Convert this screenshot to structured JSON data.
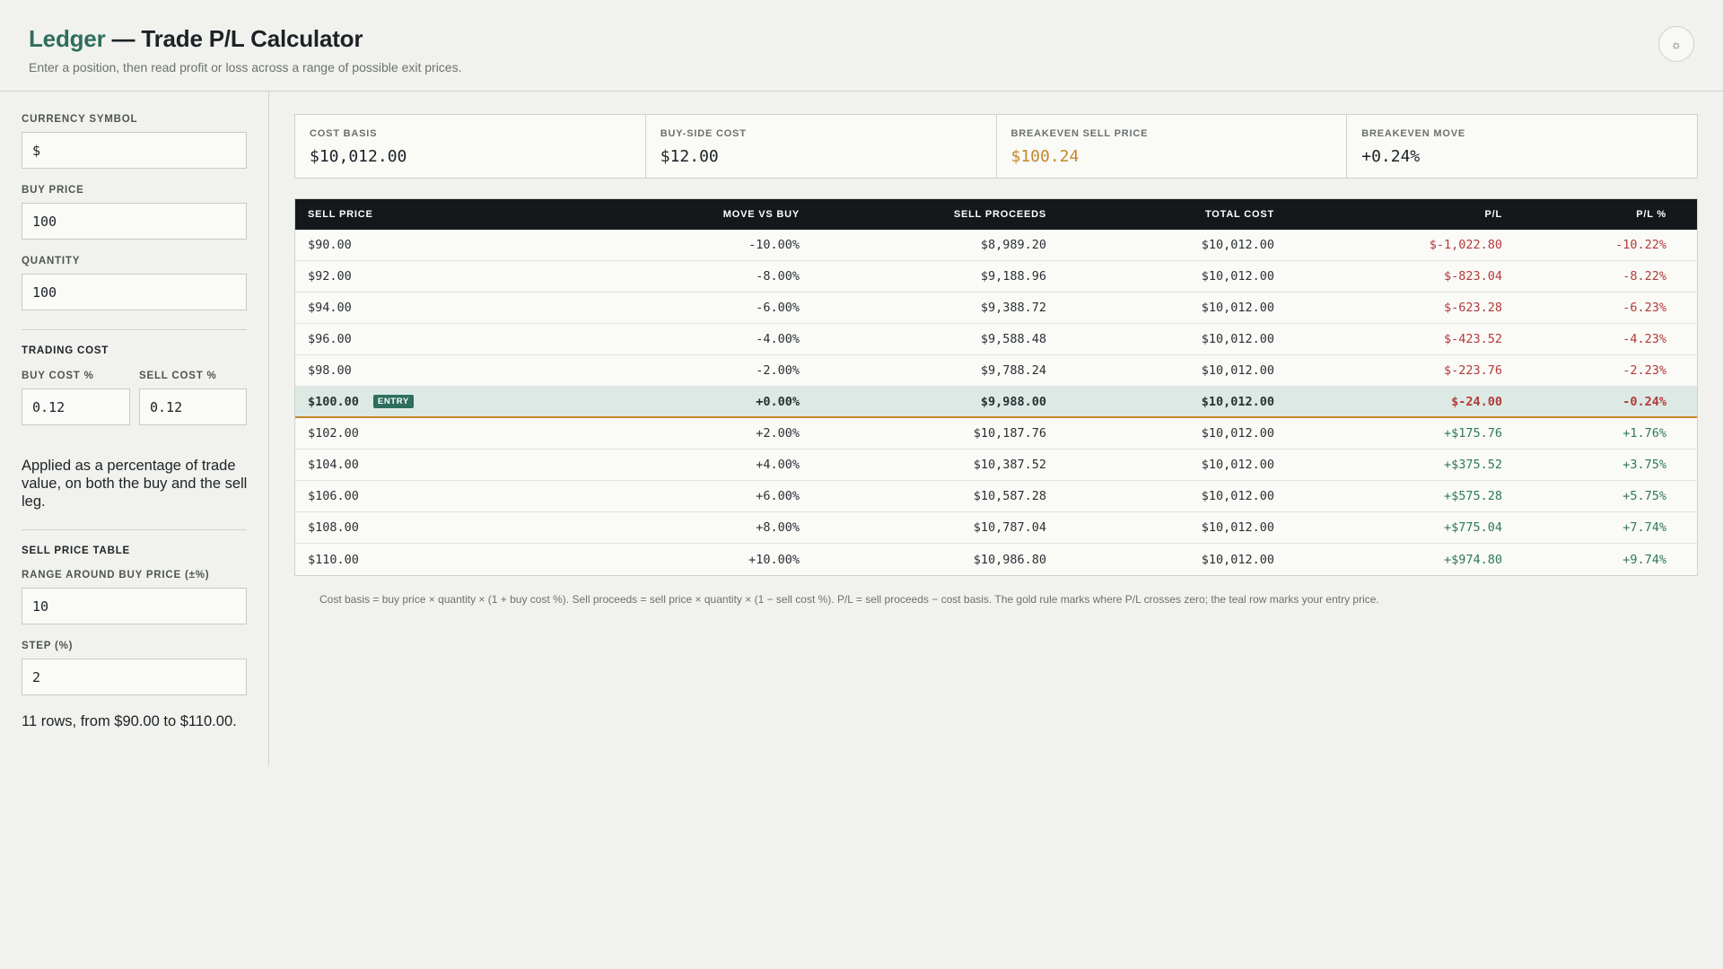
{
  "header": {
    "brand": "Ledger",
    "title_rest": " — Trade P/L Calculator",
    "subtitle": "Enter a position, then read profit or loss across a range of possible exit prices.",
    "theme_icon": "☼"
  },
  "sidebar": {
    "currency_label": "CURRENCY SYMBOL",
    "currency_value": "$",
    "buy_price_label": "BUY PRICE",
    "buy_price_value": "100",
    "quantity_label": "QUANTITY",
    "quantity_value": "100",
    "trading_cost_title": "TRADING COST",
    "buy_cost_label": "BUY COST %",
    "buy_cost_value": "0.12",
    "sell_cost_label": "SELL COST %",
    "sell_cost_value": "0.12",
    "cost_note": "Applied as a percentage of trade value, on both the buy and the sell leg.",
    "sell_table_title": "SELL PRICE TABLE",
    "range_label": "RANGE AROUND BUY PRICE (±%)",
    "range_value": "10",
    "step_label": "STEP (%)",
    "step_value": "2",
    "rows_note": "11 rows, from $90.00 to $110.00."
  },
  "stats": [
    {
      "label": "COST BASIS",
      "value": "$10,012.00",
      "accent": "none"
    },
    {
      "label": "BUY-SIDE COST",
      "value": "$12.00",
      "accent": "none"
    },
    {
      "label": "BREAKEVEN SELL PRICE",
      "value": "$100.24",
      "accent": "gold"
    },
    {
      "label": "BREAKEVEN MOVE",
      "value": "+0.24%",
      "accent": "none"
    }
  ],
  "table": {
    "headers": [
      "SELL PRICE",
      "MOVE VS BUY",
      "SELL PROCEEDS",
      "TOTAL COST",
      "P/L",
      "P/L %"
    ],
    "entry_badge": "ENTRY",
    "rows": [
      {
        "price": "$90.00",
        "move": "-10.00%",
        "proceeds": "$8,989.20",
        "cost": "$10,012.00",
        "pl": "$-1,022.80",
        "plpct": "-10.22%",
        "sign": "neg"
      },
      {
        "price": "$92.00",
        "move": "-8.00%",
        "proceeds": "$9,188.96",
        "cost": "$10,012.00",
        "pl": "$-823.04",
        "plpct": "-8.22%",
        "sign": "neg"
      },
      {
        "price": "$94.00",
        "move": "-6.00%",
        "proceeds": "$9,388.72",
        "cost": "$10,012.00",
        "pl": "$-623.28",
        "plpct": "-6.23%",
        "sign": "neg"
      },
      {
        "price": "$96.00",
        "move": "-4.00%",
        "proceeds": "$9,588.48",
        "cost": "$10,012.00",
        "pl": "$-423.52",
        "plpct": "-4.23%",
        "sign": "neg"
      },
      {
        "price": "$98.00",
        "move": "-2.00%",
        "proceeds": "$9,788.24",
        "cost": "$10,012.00",
        "pl": "$-223.76",
        "plpct": "-2.23%",
        "sign": "neg"
      },
      {
        "price": "$100.00",
        "move": "+0.00%",
        "proceeds": "$9,988.00",
        "cost": "$10,012.00",
        "pl": "$-24.00",
        "plpct": "-0.24%",
        "sign": "neg",
        "entry": true
      },
      {
        "price": "$102.00",
        "move": "+2.00%",
        "proceeds": "$10,187.76",
        "cost": "$10,012.00",
        "pl": "+$175.76",
        "plpct": "+1.76%",
        "sign": "pos"
      },
      {
        "price": "$104.00",
        "move": "+4.00%",
        "proceeds": "$10,387.52",
        "cost": "$10,012.00",
        "pl": "+$375.52",
        "plpct": "+3.75%",
        "sign": "pos"
      },
      {
        "price": "$106.00",
        "move": "+6.00%",
        "proceeds": "$10,587.28",
        "cost": "$10,012.00",
        "pl": "+$575.28",
        "plpct": "+5.75%",
        "sign": "pos"
      },
      {
        "price": "$108.00",
        "move": "+8.00%",
        "proceeds": "$10,787.04",
        "cost": "$10,012.00",
        "pl": "+$775.04",
        "plpct": "+7.74%",
        "sign": "pos"
      },
      {
        "price": "$110.00",
        "move": "+10.00%",
        "proceeds": "$10,986.80",
        "cost": "$10,012.00",
        "pl": "+$974.80",
        "plpct": "+9.74%",
        "sign": "pos"
      }
    ]
  },
  "footnote": "Cost basis = buy price × quantity × (1 + buy cost %). Sell proceeds = sell price × quantity × (1 − sell cost %). P/L = sell proceeds − cost basis. The gold rule marks where P/L crosses zero; the teal row marks your entry price.",
  "colors": {
    "brand": "#2e6e5e",
    "gold": "#c4882a",
    "negative": "#b23a3a",
    "positive": "#2d7a55",
    "header_bg": "#14181b"
  }
}
